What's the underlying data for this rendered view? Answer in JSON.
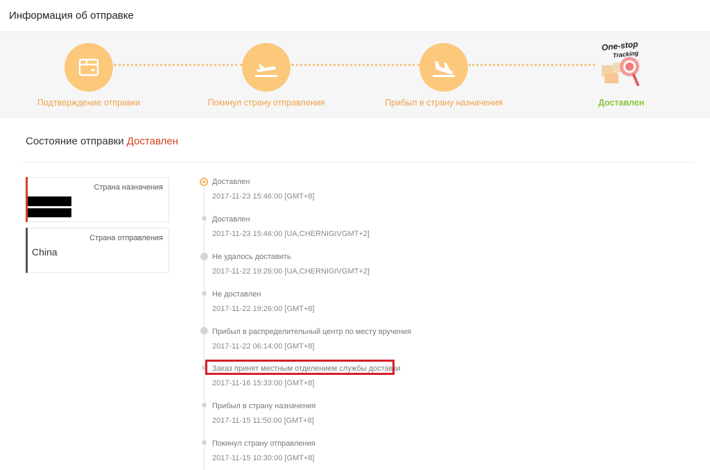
{
  "header": {
    "title": "Информация об отправке"
  },
  "progress": {
    "steps": [
      {
        "label": "Подтверждение отправки",
        "icon": "package-icon"
      },
      {
        "label": "Покинул страну отправления",
        "icon": "plane-takeoff-icon"
      },
      {
        "label": "Прибыл в страну назначения",
        "icon": "plane-landing-icon"
      },
      {
        "label": "Доставлен",
        "icon": "one-stop-tracking-logo"
      }
    ],
    "logo_text_1": "One-stop",
    "logo_text_2": "Tracking",
    "colors": {
      "accent": "#fcc87c",
      "label": "#f0a24a",
      "done": "#8dc63f"
    }
  },
  "status": {
    "prefix": "Состояние отправки",
    "value": "Доставлен",
    "color": "#d2441f"
  },
  "destination": {
    "label": "Страна назначения",
    "bar_color": "#d2441f"
  },
  "origin": {
    "label": "Страна отправления",
    "value": "China",
    "bar_color": "#555555"
  },
  "events": [
    {
      "title": "Доставлен",
      "time": "2017-11-23 15:46:00 [GMT+8]"
    },
    {
      "title": "Доставлен",
      "time": "2017-11-23 15:46:00 [UA,CHERNIGIVGMT+2]"
    },
    {
      "title": "Не удалось доставить",
      "time": "2017-11-22 19:26:00 [UA,CHERNIGIVGMT+2]"
    },
    {
      "title": "Не доставлен",
      "time": "2017-11-22 19:26:00 [GMT+8]"
    },
    {
      "title": "Прибыл в распределительный центр по месту вручения",
      "time": "2017-11-22 06:14:00 [GMT+8]"
    },
    {
      "title": "Заказ принят местным отделением службы доставки",
      "time": "2017-11-16 15:33:00 [GMT+8]"
    },
    {
      "title": "Прибыл в страну назначения",
      "time": "2017-11-15 11:50:00 [GMT+8]"
    },
    {
      "title": "Покинул страну отправления",
      "time": "2017-11-15 10:30:00 [GMT+8]"
    }
  ]
}
